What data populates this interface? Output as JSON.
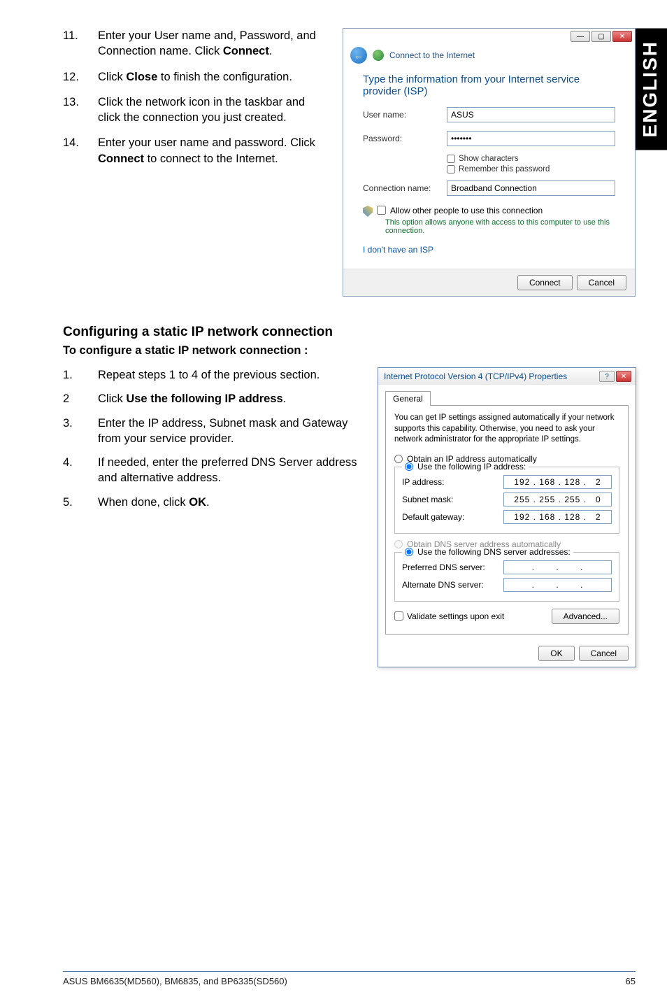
{
  "sideTab": "ENGLISH",
  "topSteps": [
    {
      "num": "11.",
      "parts": [
        "Enter your User name and, Password, and Connection name. Click ",
        {
          "bold": "Connect"
        },
        "."
      ]
    },
    {
      "num": "12.",
      "parts": [
        "Click ",
        {
          "bold": "Close"
        },
        " to finish the configuration."
      ]
    },
    {
      "num": "13.",
      "parts": [
        "Click the network icon in the taskbar and click the connection you just created."
      ]
    },
    {
      "num": "14.",
      "parts": [
        "Enter your user name and password. Click ",
        {
          "bold": "Connect"
        },
        " to connect to the Internet."
      ]
    }
  ],
  "connectDlg": {
    "header": "Connect to the Internet",
    "heading": "Type the information from your Internet service provider (ISP)",
    "userLabel": "User name:",
    "userValue": "ASUS",
    "passLabel": "Password:",
    "passValue": "•••••••",
    "showChars": "Show characters",
    "rememberPw": "Remember this password",
    "connNameLabel": "Connection name:",
    "connNameValue": "Broadband Connection",
    "allowOthers": "Allow other people to use this connection",
    "allowNote": "This option allows anyone with access to this computer to use this connection.",
    "noIsp": "I don't have an ISP",
    "btnConnect": "Connect",
    "btnCancel": "Cancel"
  },
  "staticHeading1": "Configuring a static IP network connection",
  "staticHeading2": "To configure a static IP network connection :",
  "staticSteps": [
    {
      "num": "1.",
      "parts": [
        "Repeat steps 1 to 4 of the previous section."
      ]
    },
    {
      "num": "2",
      "parts": [
        "Click ",
        {
          "bold": "Use the following IP address"
        },
        "."
      ]
    },
    {
      "num": "3.",
      "parts": [
        "Enter the IP address, Subnet mask and Gateway from your service provider."
      ]
    },
    {
      "num": "4.",
      "parts": [
        "If needed, enter the preferred DNS Server address and alternative address."
      ]
    },
    {
      "num": "5.",
      "parts": [
        "When done, click ",
        {
          "bold": "OK"
        },
        "."
      ]
    }
  ],
  "ipv4Dlg": {
    "title": "Internet Protocol Version 4 (TCP/IPv4) Properties",
    "tab": "General",
    "info": "You can get IP settings assigned automatically if your network supports this capability. Otherwise, you need to ask your network administrator for the appropriate IP settings.",
    "optAuto": "Obtain an IP address automatically",
    "optManual": "Use the following IP address:",
    "ipLabel": "IP address:",
    "ipValue": "192 . 168 . 128 .   2",
    "maskLabel": "Subnet mask:",
    "maskValue": "255 . 255 . 255 .   0",
    "gwLabel": "Default gateway:",
    "gwValue": "192 . 168 . 128 .   2",
    "dnsAuto": "Obtain DNS server address automatically",
    "dnsManual": "Use the following DNS server addresses:",
    "prefDnsLabel": "Preferred DNS server:",
    "prefDnsValue": ".       .       .",
    "altDnsLabel": "Alternate DNS server:",
    "altDnsValue": ".       .       .",
    "validate": "Validate settings upon exit",
    "advanced": "Advanced...",
    "ok": "OK",
    "cancel": "Cancel"
  },
  "footer": {
    "left": "ASUS BM6635(MD560), BM6835, and BP6335(SD560)",
    "right": "65"
  }
}
